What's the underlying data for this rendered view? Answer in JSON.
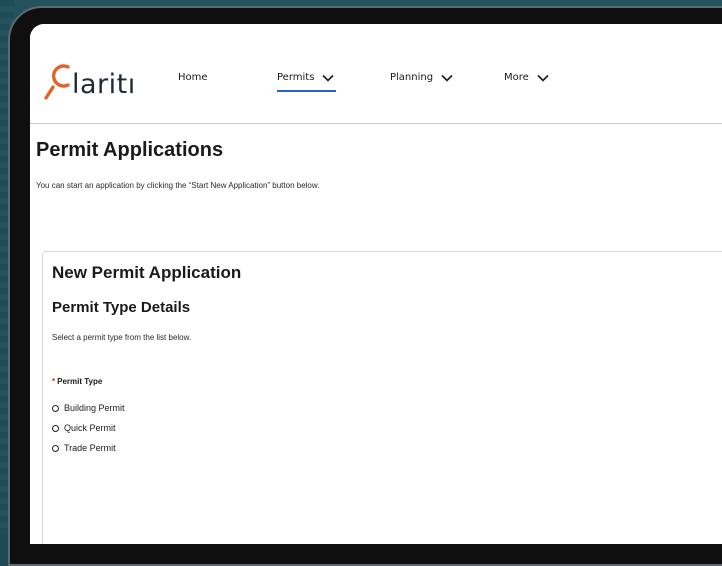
{
  "brand": {
    "logo_text": "laritı",
    "logo_accent": "#e0632a",
    "logo_text_color": "#1e2a3a"
  },
  "nav": {
    "items": [
      {
        "label": "Home",
        "has_dropdown": false,
        "active": false
      },
      {
        "label": "Permits",
        "has_dropdown": true,
        "active": true
      },
      {
        "label": "Planning",
        "has_dropdown": true,
        "active": false
      },
      {
        "label": "More",
        "has_dropdown": true,
        "active": false
      }
    ],
    "active_color": "#2b62c9"
  },
  "page": {
    "title": "Permit Applications",
    "description": "You can start an application by clicking the “Start New Application” button below."
  },
  "form": {
    "title": "New Permit Application",
    "section_title": "Permit Type Details",
    "section_description": "Select a permit type from the list below.",
    "field": {
      "required_marker": "*",
      "label": "Permit Type",
      "options": [
        "Building Permit",
        "Quick Permit",
        "Trade Permit"
      ],
      "selected": null
    }
  }
}
